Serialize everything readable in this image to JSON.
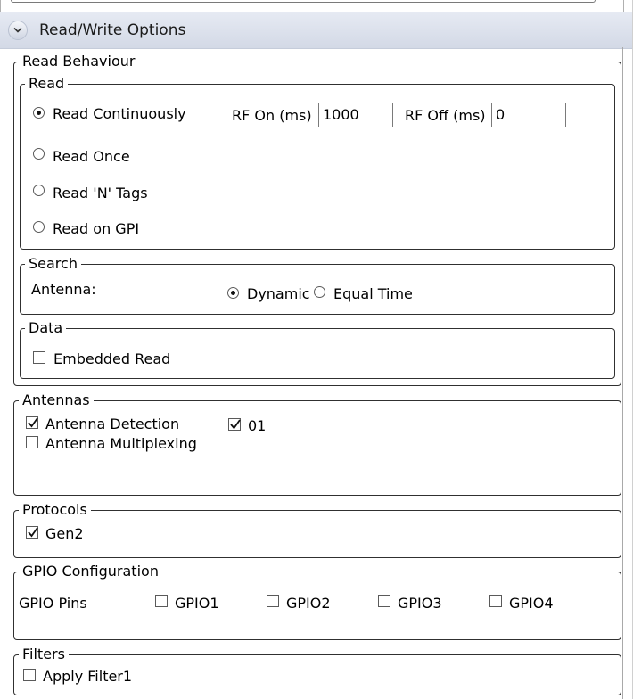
{
  "header": {
    "title": "Read/Write Options",
    "icon": "chevron-down-icon"
  },
  "read_behaviour": {
    "legend": "Read Behaviour",
    "read": {
      "legend": "Read",
      "options": [
        "Read Continuously",
        "Read Once",
        "Read 'N' Tags",
        "Read on GPI"
      ],
      "selected": "Read Continuously",
      "rf_on_label": "RF On (ms)",
      "rf_on_value": "1000",
      "rf_off_label": "RF Off (ms)",
      "rf_off_value": "0"
    },
    "search": {
      "legend": "Search",
      "antenna_label": "Antenna:",
      "options": [
        "Dynamic",
        "Equal Time"
      ],
      "selected": "Dynamic"
    },
    "data": {
      "legend": "Data",
      "embedded_read": {
        "label": "Embedded Read",
        "checked": false
      }
    }
  },
  "antennas": {
    "legend": "Antennas",
    "detection": {
      "label": "Antenna Detection",
      "checked": true
    },
    "multiplexing": {
      "label": "Antenna Multiplexing",
      "checked": false
    },
    "port_01": {
      "label": "01",
      "checked": true
    }
  },
  "protocols": {
    "legend": "Protocols",
    "gen2": {
      "label": "Gen2",
      "checked": true
    }
  },
  "gpio": {
    "legend": "GPIO Configuration",
    "pins_label": "GPIO Pins",
    "pins": [
      "GPIO1",
      "GPIO2",
      "GPIO3",
      "GPIO4"
    ]
  },
  "filters": {
    "legend": "Filters",
    "apply_filter1": {
      "label": "Apply Filter1",
      "checked": false
    }
  }
}
